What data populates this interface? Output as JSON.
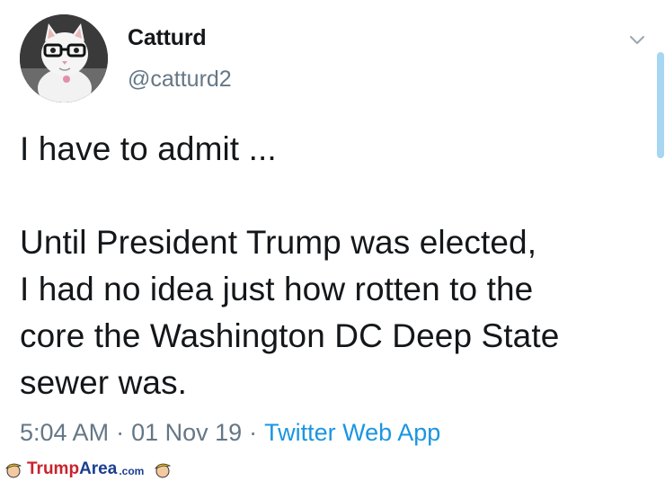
{
  "tweet": {
    "display_name": "Catturd",
    "handle": "@catturd2",
    "text": "I have to admit ...\n\nUntil President Trump was elected,\nI had no idea just how rotten to the\ncore the Washington DC Deep State\nsewer was.",
    "time": "5:04 AM",
    "separator": "·",
    "date": "01 Nov 19",
    "source": "Twitter Web App"
  },
  "watermark": {
    "part1": "Trump",
    "part2": "Area",
    "part3": ".com"
  },
  "icons": {
    "avatar": "cat-with-glasses-avatar",
    "chevron": "chevron-down-icon",
    "watermark_heads": "trump-head-icon"
  },
  "colors": {
    "text": "#14171a",
    "secondary": "#657786",
    "link": "#1b95e0",
    "scrollbar": "#a7d6f2",
    "watermark_red": "#c8232c",
    "watermark_blue": "#1b3f8f"
  }
}
